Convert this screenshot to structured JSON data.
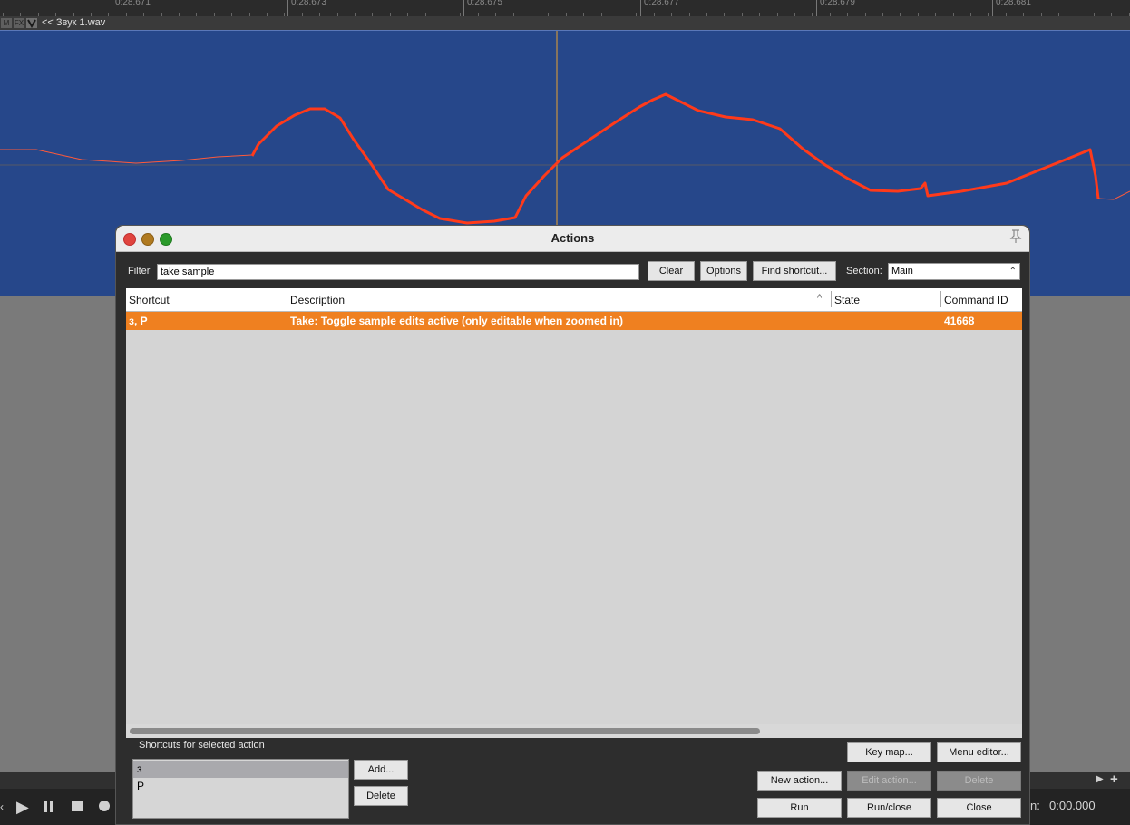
{
  "ruler": {
    "ticks": [
      "0:28.671",
      "0:28.673",
      "0:28.675",
      "0:28.677",
      "0:28.679",
      "0:28.681"
    ]
  },
  "track": {
    "mute_label": "M",
    "fx_label": "FX",
    "name": "<< Звук 1.wav"
  },
  "dialog": {
    "title": "Actions",
    "filter_label": "Filter",
    "filter_value": "take sample",
    "clear": "Clear",
    "options": "Options",
    "find_shortcut": "Find shortcut...",
    "section_label": "Section:",
    "section_value": "Main",
    "columns": {
      "shortcut": "Shortcut",
      "description": "Description",
      "state": "State",
      "command_id": "Command ID"
    },
    "rows": [
      {
        "shortcut": "з, P",
        "description": "Take: Toggle sample edits active (only editable when zoomed in)",
        "state": "",
        "command_id": "41668"
      }
    ],
    "shortcuts_label": "Shortcuts for selected action",
    "shortcuts": [
      "з",
      "P"
    ],
    "add": "Add...",
    "delete_shortcut": "Delete",
    "key_map": "Key map...",
    "menu_editor": "Menu editor...",
    "new_action": "New action...",
    "edit_action": "Edit action...",
    "delete_action": "Delete",
    "run": "Run",
    "run_close": "Run/close",
    "close": "Close"
  },
  "transport": {
    "time": "0:00.000",
    "partial_label": "n:"
  },
  "colors": {
    "waveform_bg": "#26478a",
    "waveform_line": "#ff3a1a",
    "selection": "#ef8020",
    "close_light": "#e0443e",
    "minimize_light": "#b07a20",
    "zoom_light": "#2a9a2a"
  }
}
